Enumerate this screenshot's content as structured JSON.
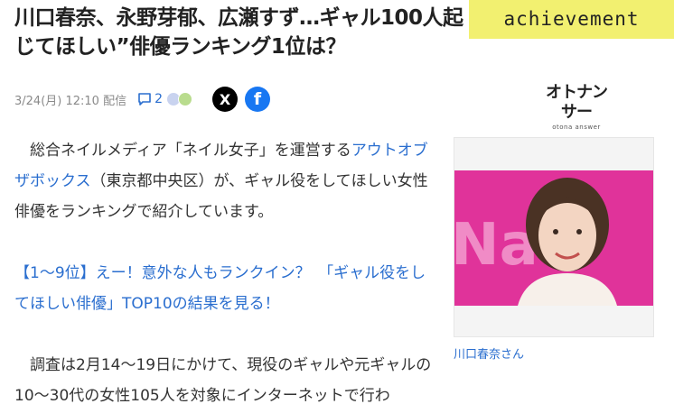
{
  "headline": {
    "line1": "川口春奈、永野芽郁、広瀬すず…ギャル100人起",
    "line2": "じてほしい”俳優ランキング1位は？"
  },
  "badge": "achievement",
  "meta": {
    "date": "3/24(月) 12:10 配信",
    "comment_count": "2",
    "share_x": "X",
    "share_facebook": "f"
  },
  "publisher": {
    "logo_text": "オトナンサー",
    "logo_sub": "otona answer"
  },
  "article": {
    "lead_before": "総合ネイルメディア「ネイル女子」を運営する",
    "lead_link": "アウトオブザボックス",
    "lead_after": "（東京都中央区）が、ギャル役をしてほしい女性俳優をランキングで紹介しています。",
    "promo_link": "【1〜9位】えー！意外な人もランクイン？　「ギャル役をしてほしい俳優」TOP10の結果を見る！",
    "p2": "調査は2月14〜19日にかけて、現役のギャルや元ギャルの10〜30代の女性105人を対象にインターネットで行わ"
  },
  "photo": {
    "backdrop_text": "Na",
    "caption": "川口春奈さん"
  },
  "colors": {
    "link": "#2a6ecf",
    "badge": "#f2f070",
    "photo_backdrop": "#e0339a"
  },
  "icons": [
    "comment-icon",
    "x-logo-icon",
    "facebook-logo-icon"
  ]
}
